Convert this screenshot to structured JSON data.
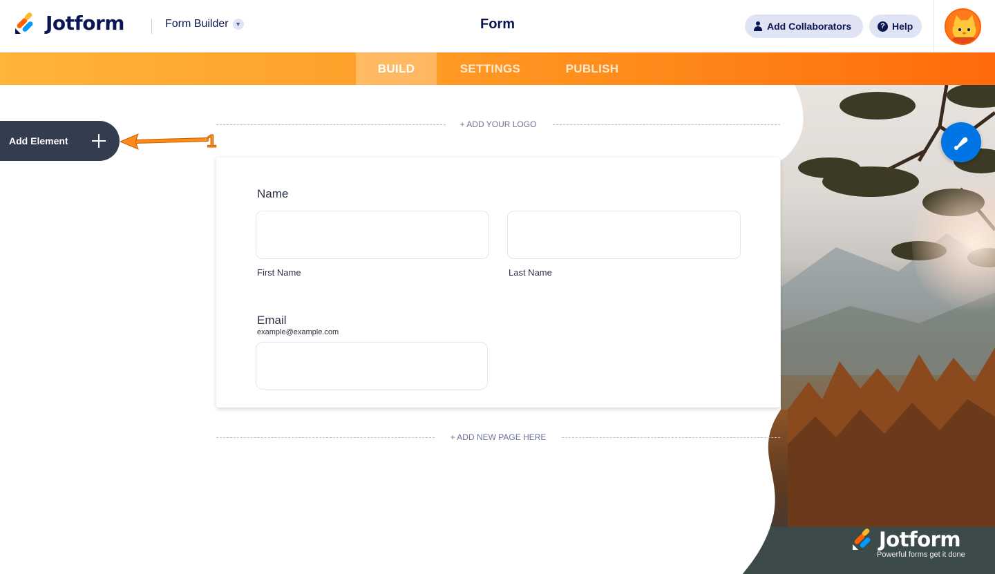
{
  "header": {
    "brand": "Jotform",
    "builder_menu": "Form Builder",
    "form_title": "Form",
    "add_collaborators": "Add Collaborators",
    "help": "Help"
  },
  "tabs": [
    {
      "label": "BUILD",
      "active": true
    },
    {
      "label": "SETTINGS",
      "active": false
    },
    {
      "label": "PUBLISH",
      "active": false
    }
  ],
  "sidebar": {
    "add_element": "Add Element"
  },
  "annotation": {
    "number": "1",
    "color": "#ff8a1a"
  },
  "canvas": {
    "add_logo": "+ ADD YOUR LOGO",
    "add_page": "+ ADD NEW PAGE HERE"
  },
  "form": {
    "name_label": "Name",
    "first_name_sub": "First Name",
    "last_name_sub": "Last Name",
    "email_label": "Email",
    "email_hint": "example@example.com"
  },
  "watermark": {
    "brand": "Jotform",
    "tagline": "Powerful forms get it done"
  },
  "colors": {
    "brand_navy": "#0a1551",
    "nav_orange_start": "#ffb43a",
    "nav_orange_end": "#ff6a0a",
    "paint_button": "#0075e3",
    "add_element_bg": "#343c50"
  },
  "icons": [
    "jotform-logo-icon",
    "chevron-down-icon",
    "user-icon",
    "help-icon",
    "avatar",
    "plus-icon",
    "paint-brush-icon"
  ]
}
